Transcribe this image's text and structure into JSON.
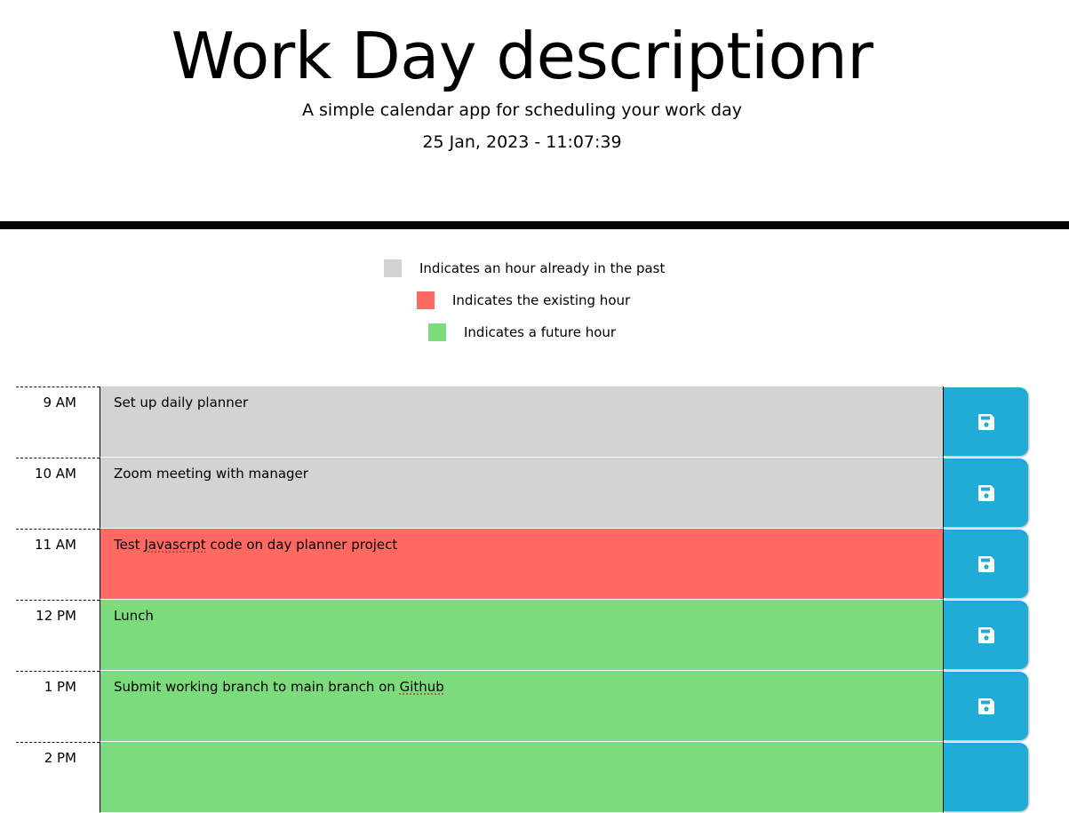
{
  "header": {
    "title": "Work Day descriptionr",
    "subtitle": "A simple calendar app for scheduling your work day",
    "datetime": "25 Jan, 2023 - 11:07:39"
  },
  "legend": [
    {
      "label": "Indicates an hour already in the past",
      "color": "#d3d3d3"
    },
    {
      "label": "Indicates the existing hour",
      "color": "#ff6961"
    },
    {
      "label": "Indicates a future hour",
      "color": "#7bdb7d"
    }
  ],
  "colors": {
    "past": "#d3d3d3",
    "present": "#ff6961",
    "future": "#7bdb7d",
    "save_button": "#20acd6"
  },
  "timeblocks": [
    {
      "hour": "9 AM",
      "description": "Set up daily planner",
      "state": "past",
      "save_icon": "floppy-disk-icon"
    },
    {
      "hour": "10 AM",
      "description": "Zoom meeting with manager",
      "state": "past",
      "save_icon": "floppy-disk-icon"
    },
    {
      "hour": "11 AM",
      "description": "Test Javascrpt code on day planner project",
      "state": "present",
      "save_icon": "floppy-disk-icon"
    },
    {
      "hour": "12 PM",
      "description": "Lunch",
      "state": "future",
      "save_icon": "floppy-disk-icon"
    },
    {
      "hour": "1 PM",
      "description": "Submit working branch to main branch on Github",
      "state": "future",
      "save_icon": "floppy-disk-icon"
    },
    {
      "hour": "2 PM",
      "description": "",
      "state": "future",
      "save_icon": "floppy-disk-icon"
    }
  ]
}
